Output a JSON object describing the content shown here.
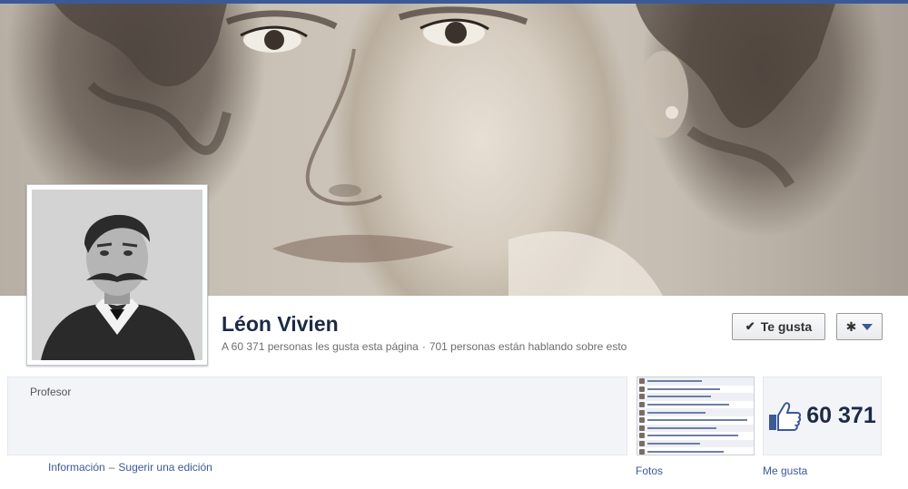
{
  "page": {
    "name": "Léon Vivien",
    "likes_text": "A 60 371 personas les gusta esta página",
    "talking_text": "701 personas están hablando sobre esto",
    "category": "Profesor"
  },
  "actions": {
    "like_label": "Te gusta",
    "settings_icon": "gear-icon"
  },
  "about_links": {
    "info": "Información",
    "separator": "–",
    "suggest_edit": "Sugerir una edición"
  },
  "tiles": {
    "photos_label": "Fotos",
    "likes_label": "Me gusta",
    "likes_count": "60 371"
  },
  "colors": {
    "brand": "#3b5998",
    "name": "#1c2a47"
  }
}
